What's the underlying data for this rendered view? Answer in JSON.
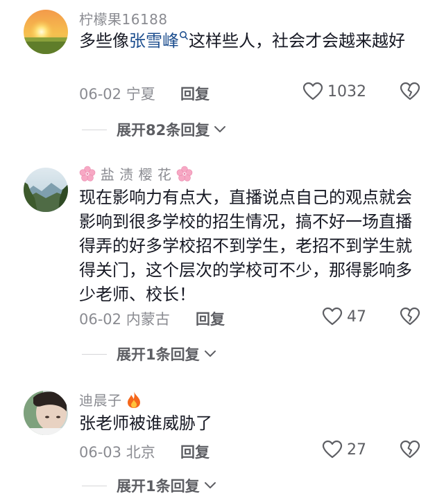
{
  "comments": [
    {
      "username": "柠檬果16188",
      "text_before": "多些像",
      "mention": "张雪峰",
      "text_after": "这样些人，社会才会越来越好",
      "date": "06-02",
      "location": "宁夏",
      "reply_label": "回复",
      "likes": "1032",
      "expand_label": "展开82条回复",
      "avatar": "sunset-field"
    },
    {
      "username_decor": "盐 渍 樱 花",
      "text": "现在影响力有点大，直播说点自己的观点就会影响到很多学校的招生情况，搞不好一场直播得弄的好多学校招不到学生，老招不到学生就得关门，这个层次的学校可不少，那得影响多少老师、校长！",
      "date": "06-02",
      "location": "内蒙古",
      "reply_label": "回复",
      "likes": "47",
      "expand_label": "展开1条回复",
      "avatar": "mountain-landscape"
    },
    {
      "username": "迪晨子",
      "text": "张老师被谁威胁了",
      "date": "06-03",
      "location": "北京",
      "reply_label": "回复",
      "likes": "27",
      "expand_label": "展开1条回复",
      "avatar": "person-portrait"
    }
  ],
  "icons": {
    "like": "heart-icon",
    "dislike": "broken-heart-icon",
    "expand": "chevron-down-icon",
    "search": "search-icon",
    "flower": "cherry-blossom-emoji",
    "fire": "fire-emoji"
  },
  "colors": {
    "text": "#161823",
    "secondary": "#8a8b91",
    "mention": "#1e4f8f",
    "action": "#5d5e63"
  }
}
